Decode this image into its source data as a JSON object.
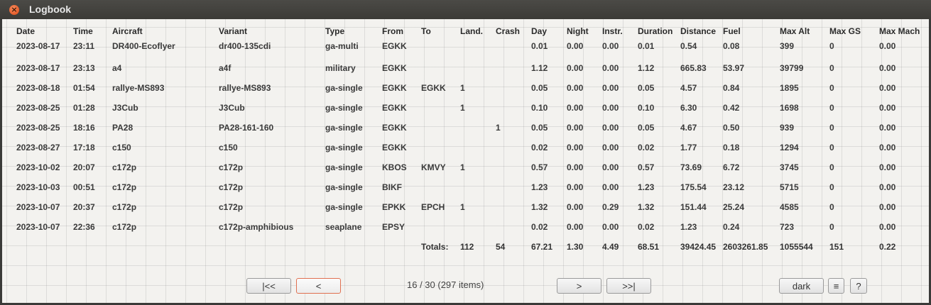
{
  "window": {
    "title": "Logbook"
  },
  "table": {
    "headers": [
      "Date",
      "Time",
      "Aircraft",
      "Variant",
      "Type",
      "From",
      "To",
      "Land.",
      "Crash",
      "Day",
      "Night",
      "Instr.",
      "Duration",
      "Distance",
      "Fuel",
      "Max Alt",
      "Max GS",
      "Max Mach"
    ],
    "rows": [
      [
        "2023-08-17",
        "23:11",
        "DR400-Ecoflyer",
        "dr400-135cdi",
        "ga-multi",
        "EGKK",
        "",
        "",
        "",
        "0.01",
        "0.00",
        "0.00",
        "0.01",
        "0.54",
        "0.08",
        "399",
        "0",
        "0.00"
      ],
      [
        "2023-08-17",
        "23:13",
        "a4",
        "a4f",
        "military",
        "EGKK",
        "",
        "",
        "",
        "1.12",
        "0.00",
        "0.00",
        "1.12",
        "665.83",
        "53.97",
        "39799",
        "0",
        "0.00"
      ],
      [
        "2023-08-18",
        "01:54",
        "rallye-MS893",
        "rallye-MS893",
        "ga-single",
        "EGKK",
        "EGKK",
        "1",
        "",
        "0.05",
        "0.00",
        "0.00",
        "0.05",
        "4.57",
        "0.84",
        "1895",
        "0",
        "0.00"
      ],
      [
        "2023-08-25",
        "01:28",
        "J3Cub",
        "J3Cub",
        "ga-single",
        "EGKK",
        "",
        "1",
        "",
        "0.10",
        "0.00",
        "0.00",
        "0.10",
        "6.30",
        "0.42",
        "1698",
        "0",
        "0.00"
      ],
      [
        "2023-08-25",
        "18:16",
        "PA28",
        "PA28-161-160",
        "ga-single",
        "EGKK",
        "",
        "",
        "1",
        "0.05",
        "0.00",
        "0.00",
        "0.05",
        "4.67",
        "0.50",
        "939",
        "0",
        "0.00"
      ],
      [
        "2023-08-27",
        "17:18",
        "c150",
        "c150",
        "ga-single",
        "EGKK",
        "",
        "",
        "",
        "0.02",
        "0.00",
        "0.00",
        "0.02",
        "1.77",
        "0.18",
        "1294",
        "0",
        "0.00"
      ],
      [
        "2023-10-02",
        "20:07",
        "c172p",
        "c172p",
        "ga-single",
        "KBOS",
        "KMVY",
        "1",
        "",
        "0.57",
        "0.00",
        "0.00",
        "0.57",
        "73.69",
        "6.72",
        "3745",
        "0",
        "0.00"
      ],
      [
        "2023-10-03",
        "00:51",
        "c172p",
        "c172p",
        "ga-single",
        "BIKF",
        "",
        "",
        "",
        "1.23",
        "0.00",
        "0.00",
        "1.23",
        "175.54",
        "23.12",
        "5715",
        "0",
        "0.00"
      ],
      [
        "2023-10-07",
        "20:37",
        "c172p",
        "c172p",
        "ga-single",
        "EPKK",
        "EPCH",
        "1",
        "",
        "1.32",
        "0.00",
        "0.29",
        "1.32",
        "151.44",
        "25.24",
        "4585",
        "0",
        "0.00"
      ],
      [
        "2023-10-07",
        "22:36",
        "c172p",
        "c172p-amphibious",
        "seaplane",
        "EPSY",
        "",
        "",
        "",
        "0.02",
        "0.00",
        "0.00",
        "0.02",
        "1.23",
        "0.24",
        "723",
        "0",
        "0.00"
      ]
    ],
    "totals": {
      "label": "Totals:",
      "values": [
        "112",
        "54",
        "67.21",
        "1.30",
        "4.49",
        "68.51",
        "39424.45",
        "2603261.85",
        "1055544",
        "151",
        "0.22"
      ]
    }
  },
  "pagination": {
    "first_label": "|<<",
    "prev_label": "<",
    "info": "16 / 30 (297 items)",
    "next_label": ">",
    "last_label": ">>|"
  },
  "controls": {
    "theme_label": "dark",
    "menu_label": "≡",
    "help_label": "?"
  },
  "colors": {
    "accent_border": "#e07050",
    "close_button": "#df4a16"
  }
}
